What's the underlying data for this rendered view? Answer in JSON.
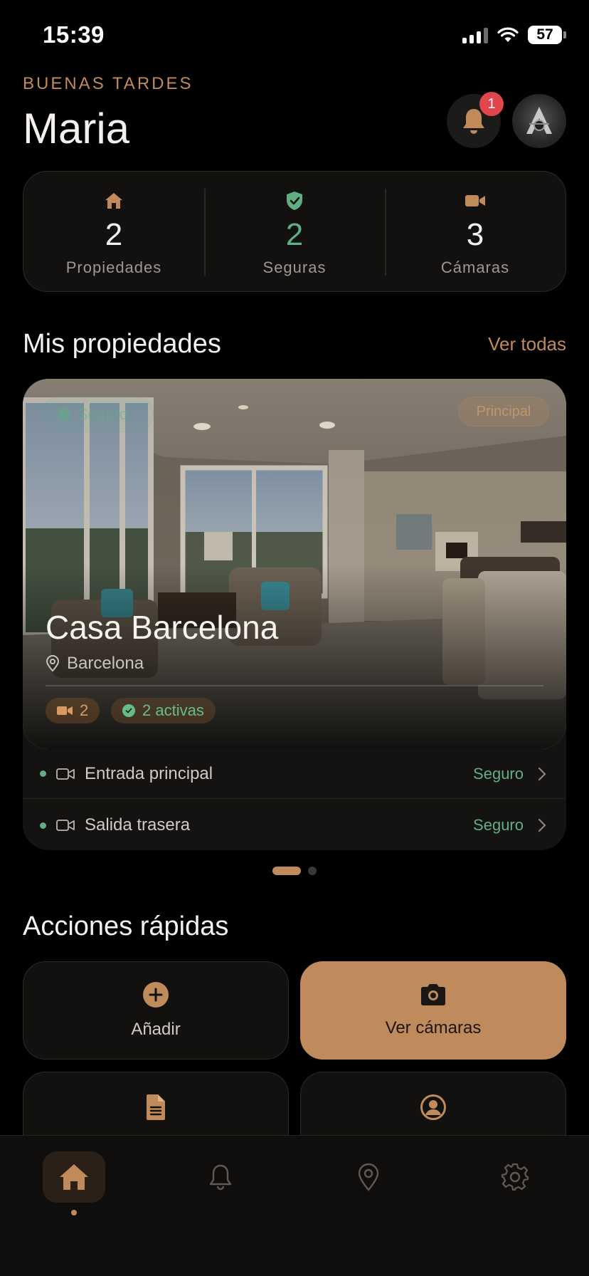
{
  "status_bar": {
    "time": "15:39",
    "battery": "57"
  },
  "header": {
    "greeting": "BUENAS TARDES",
    "user_name": "Maria",
    "notification_count": "1"
  },
  "stats": [
    {
      "icon": "house-icon",
      "value": "2",
      "label": "Propiedades"
    },
    {
      "icon": "shield-check-icon",
      "value": "2",
      "label": "Seguras"
    },
    {
      "icon": "video-camera-icon",
      "value": "3",
      "label": "Cámaras"
    }
  ],
  "properties_section": {
    "title": "Mis propiedades",
    "see_all": "Ver todas"
  },
  "property": {
    "badge_status": "Seguro",
    "badge_main": "Principal",
    "name": "Casa Barcelona",
    "location": "Barcelona",
    "camera_count": "2",
    "active_label": "2 activas",
    "cameras": [
      {
        "name": "Entrada principal",
        "status": "Seguro"
      },
      {
        "name": "Salida trasera",
        "status": "Seguro"
      }
    ]
  },
  "pager": {
    "pages": 2,
    "current": 1
  },
  "quick_actions": {
    "title": "Acciones rápidas",
    "items": [
      {
        "label": "Añadir",
        "icon": "plus-circle-icon"
      },
      {
        "label": "Ver cámaras",
        "icon": "camera-icon"
      },
      {
        "label": "",
        "icon": "document-icon"
      },
      {
        "label": "",
        "icon": "user-circle-icon"
      }
    ]
  },
  "bottom_nav": [
    {
      "name": "home",
      "icon": "home-icon",
      "active": true
    },
    {
      "name": "notifications",
      "icon": "bell-icon",
      "active": false
    },
    {
      "name": "locations",
      "icon": "map-pin-icon",
      "active": false
    },
    {
      "name": "settings",
      "icon": "gear-icon",
      "active": false
    }
  ],
  "colors": {
    "accent": "#c08a5b",
    "success": "#5fae84",
    "badge": "#e0464b",
    "background": "#000000"
  }
}
